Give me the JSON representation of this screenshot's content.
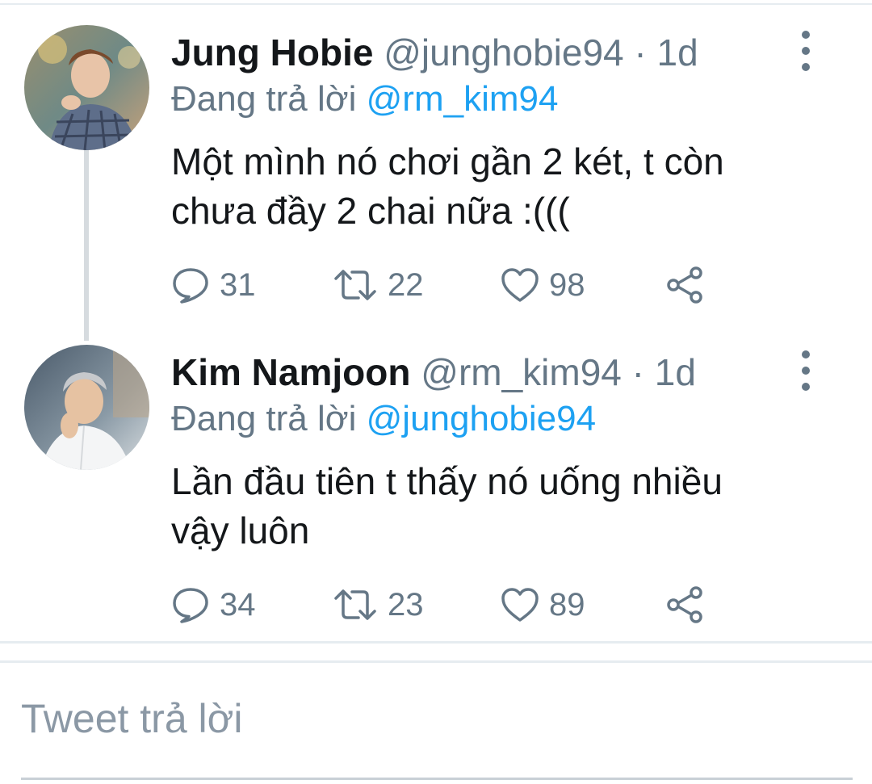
{
  "tweets": [
    {
      "author_name": "Jung Hobie",
      "author_handle": "@junghobie94",
      "separator": "·",
      "time_ago": "1d",
      "reply_prefix": "Đang trả lời",
      "reply_to": "@rm_kim94",
      "text_line1": "Một mình nó chơi gần 2 két, t còn",
      "text_line2": "chưa đầy 2 chai nữa :(((",
      "reply_count": "31",
      "retweet_count": "22",
      "like_count": "98"
    },
    {
      "author_name": "Kim Namjoon",
      "author_handle": "@rm_kim94",
      "separator": "·",
      "time_ago": "1d",
      "reply_prefix": "Đang trả lời",
      "reply_to": "@junghobie94",
      "text_line1": "Lần đầu tiên t thấy nó uống nhiều",
      "text_line2": "vậy luôn",
      "reply_count": "34",
      "retweet_count": "23",
      "like_count": "89"
    }
  ],
  "reply_box": {
    "placeholder": "Tweet trả lời"
  },
  "icons": {
    "reply": "reply-bubble-icon",
    "retweet": "retweet-icon",
    "like": "heart-icon",
    "share": "share-icon",
    "more": "more-vertical-icon"
  },
  "colors": {
    "text": "#14171a",
    "muted": "#657786",
    "link": "#1da1f2",
    "divider": "#e6ecf0"
  }
}
